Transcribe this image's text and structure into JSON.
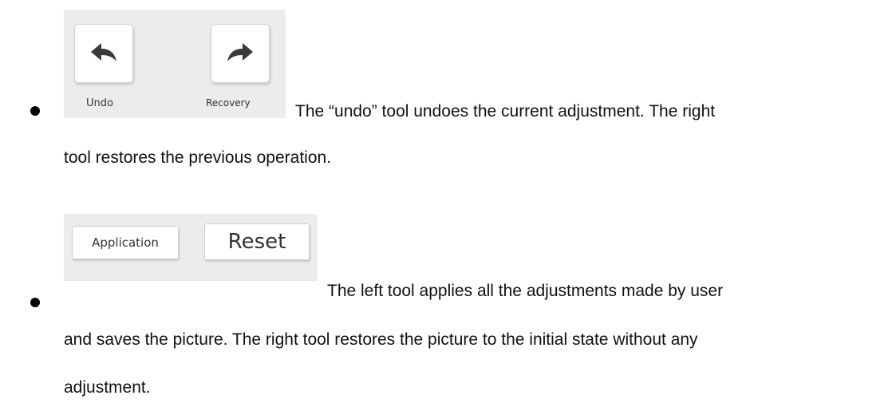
{
  "item1": {
    "tools": {
      "undo_label": "Undo",
      "recovery_label": "Recovery",
      "undo_icon": "undo-arrow-icon",
      "recovery_icon": "redo-arrow-icon"
    },
    "line1": "The “undo” tool undoes the current adjustment. The right",
    "line2": "tool restores the previous operation."
  },
  "item2": {
    "buttons": {
      "application_label": "Application",
      "reset_label": "Reset"
    },
    "line1": "The left tool applies all the adjustments made by user",
    "line2": "and saves the picture. The right tool restores the picture to the initial state without any",
    "line3": "adjustment."
  },
  "colors": {
    "panel_bg": "#ececec",
    "button_bg": "#ffffff",
    "text": "#111111"
  }
}
